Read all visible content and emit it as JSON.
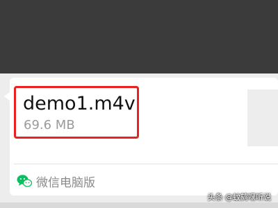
{
  "file_message": {
    "file_name": "demo1.m4v",
    "file_size": "69.6 MB",
    "source_label": "微信电脑版",
    "source_icon": "wechat-icon"
  },
  "watermark": {
    "text": "头条 @蚊鸫嘿听说"
  },
  "colors": {
    "highlight_border": "#e8231f",
    "top_bar": "#3b3b3b",
    "chat_background": "#ededed",
    "wechat_green": "#07c160"
  }
}
